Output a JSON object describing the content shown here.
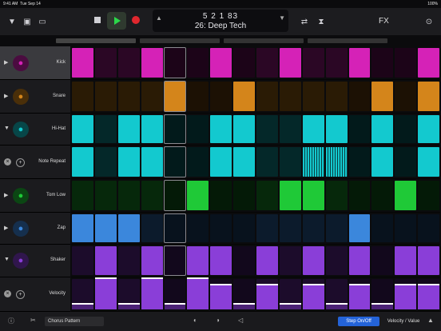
{
  "status": {
    "time": "9:41 AM",
    "date": "Tue Sep 14",
    "battery": "100%"
  },
  "toolbar": {
    "icons": [
      "browser-dropdown-icon",
      "library-icon",
      "window-icon"
    ],
    "lcd_position": "5 2 1   83",
    "lcd_pattern_name": "26: Deep Tech",
    "fx_label": "FX"
  },
  "colors": {
    "kick": "#d522b7",
    "snare": "#d4851b",
    "hihat": "#13c9cf",
    "tom": "#1fc937",
    "zap": "#3b87dc",
    "shaker": "#8a3ed8"
  },
  "tracks": [
    {
      "label": "Kick",
      "icon": "kick-drum-icon"
    },
    {
      "label": "Snare",
      "icon": "snare-drum-icon"
    },
    {
      "label": "Hi-Hat",
      "icon": "hihat-icon"
    },
    {
      "label": "Note Repeat",
      "icon": "note-repeat-icon"
    },
    {
      "label": "Tom Low",
      "icon": "tom-drum-icon"
    },
    {
      "label": "Zap",
      "icon": "zap-icon"
    },
    {
      "label": "Shaker",
      "icon": "shaker-icon"
    },
    {
      "label": "Velocity",
      "icon": "velocity-icon"
    }
  ],
  "bottom": {
    "pattern_name": "Chorus Pattern",
    "step_onoff_label": "Step On/Off",
    "velocity_value_label": "Velocity / Value"
  },
  "steps": {
    "kick": [
      1,
      0,
      0,
      1,
      0,
      0,
      1,
      0,
      0,
      1,
      0,
      0,
      1,
      0,
      0,
      1
    ],
    "snare": [
      0,
      0,
      0,
      0,
      1,
      0,
      0,
      1,
      0,
      0,
      0,
      0,
      0,
      1,
      0,
      1
    ],
    "hihat": [
      1,
      0,
      1,
      1,
      0,
      0,
      1,
      1,
      0,
      0,
      1,
      1,
      0,
      1,
      0,
      1
    ],
    "repeat": [
      1,
      0,
      1,
      1,
      0,
      0,
      1,
      1,
      0,
      0,
      1,
      1,
      0,
      1,
      0,
      1
    ],
    "tom": [
      0,
      0,
      0,
      0,
      0,
      1,
      0,
      0,
      0,
      1,
      1,
      0,
      0,
      0,
      1,
      0
    ],
    "zap": [
      1,
      1,
      1,
      0,
      0,
      0,
      0,
      0,
      0,
      0,
      0,
      0,
      1,
      0,
      0,
      0
    ],
    "shaker": [
      0,
      1,
      0,
      1,
      0,
      1,
      1,
      0,
      1,
      0,
      1,
      0,
      1,
      0,
      1,
      1
    ],
    "velocity": [
      0.15,
      1,
      0.15,
      1,
      0.15,
      1,
      0.8,
      0.15,
      0.8,
      0.15,
      0.8,
      0.15,
      0.8,
      0.15,
      0.8,
      0.8
    ]
  }
}
